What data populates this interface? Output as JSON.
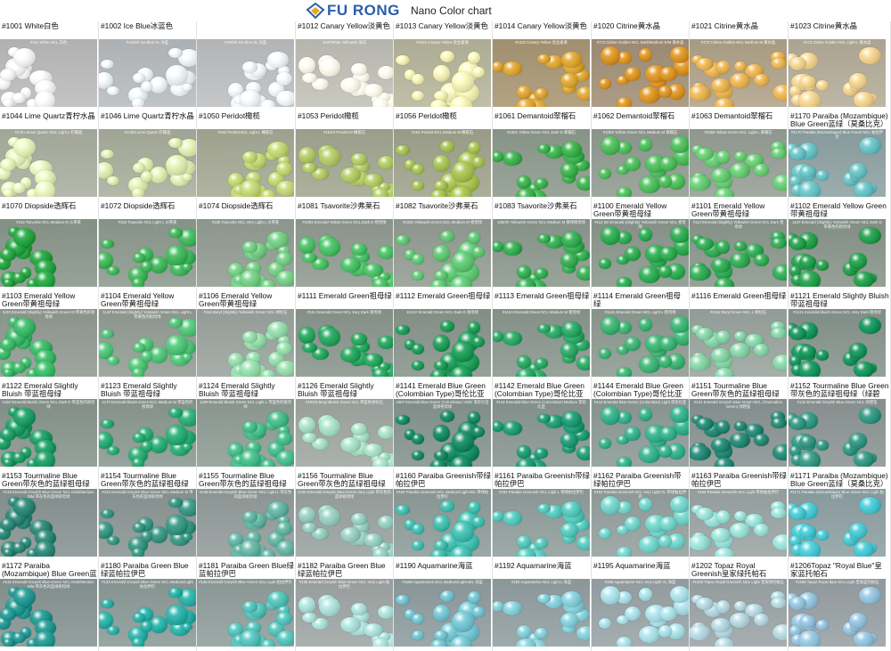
{
  "header": {
    "brand": "FU RONG",
    "chart_title": "Nano Color chart",
    "brand_color": "#2c5ea8",
    "logo_icon": "diamond-logo-icon"
  },
  "rows": [
    [
      {
        "label": "#1001 White白色",
        "cap": "#101 White NCL 白色",
        "color": "#e8e8e8",
        "photo_bg": "#b8b8b8"
      },
      {
        "label": "#1002 Ice Blue冰蓝色",
        "cap": "#1002# Ice Blue VL 冰蓝",
        "color": "#dfe6ea",
        "photo_bg": "#b5b8ba"
      },
      {
        "label": "",
        "cap": "#1002# Ice Blue SL 冰蓝",
        "color": "#e2e8ec",
        "photo_bg": "#b9bbbd"
      },
      {
        "label": "#1012 Canary Yellow淡黄色",
        "cap": "102#White Yellowish 米白",
        "color": "#eeeede",
        "photo_bg": "#bdbdb5"
      },
      {
        "label": "#1013 Canary Yellow淡黄色",
        "cap": "#1022 Canary Yellow 金丝雀黄",
        "color": "#e5e3a8",
        "photo_bg": "#b4b39b"
      },
      {
        "label": "#1014 Canary Yellow淡黄色",
        "cap": "#1023 Canary Yellow 金丝雀黄",
        "color": "#d09a2c",
        "photo_bg": "#a89776"
      },
      {
        "label": "#1020 Citrine黄水晶",
        "cap": "#173 Citrine Golden NCL Dark/Medium D/M 黄水晶",
        "color": "#cf8a1e",
        "photo_bg": "#a2917a"
      },
      {
        "label": "#1021 Citrine黄水晶",
        "cap": "#172 Citrine Golden NCL Medium M 黄水晶",
        "color": "#dba84a",
        "photo_bg": "#aea28b"
      },
      {
        "label": "#1023 Citrine黄水晶",
        "cap": "#173 Citrine Golden NCL Light L 黄水晶",
        "color": "#e3c685",
        "photo_bg": "#b3ab9a"
      }
    ],
    [
      {
        "label": "#1044 Lime Quartz青柠水晶",
        "cap": "#178 Lemon Quartz NCL Light L 柠檬晶",
        "color": "#d8e4b0",
        "photo_bg": "#a9ad9f"
      },
      {
        "label": "#1046 Lime Quartz青柠水晶",
        "cap": "#178/2 Lime Quartz 柠檬晶",
        "color": "#d2dea6",
        "photo_bg": "#a8ac9c"
      },
      {
        "label": "#1050 Peridot橄榄",
        "cap": "#152 Peridot NCL Light L 橄榄石",
        "color": "#b5c96a",
        "photo_bg": "#a4a895"
      },
      {
        "label": "#1053 Peridot橄榄",
        "cap": "#152/3 Peridot M 橄榄石",
        "color": "#a6bd5d",
        "photo_bg": "#a1a591"
      },
      {
        "label": "#1056 Peridot橄榄",
        "cap": "#153 Peridot NCL Medium M 橄榄石",
        "color": "#9bb54a",
        "photo_bg": "#9fa38e"
      },
      {
        "label": "#1061 Demantoid翠榴石",
        "cap": "#1061 Yellow Green NCL Dark D 翠榴石",
        "color": "#33a545",
        "photo_bg": "#8f9a8f"
      },
      {
        "label": "#1062 Demantoid翠榴石",
        "cap": "#1069 Yellow Green NCL Medium M 翠榴石",
        "color": "#45b152",
        "photo_bg": "#929b92"
      },
      {
        "label": "#1063 Demantoid翠榴石",
        "cap": "#1069 Yellow Green NCL Light L 翠榴石",
        "color": "#5ec06a",
        "photo_bg": "#969e96"
      },
      {
        "label": "#1170 Paraiba (Mozambique) Blue Green蓝绿（莫桑比克）帕拉伊巴",
        "cap": "#1170 Paraiba (Mozambique) Blue Green NCL 帕拉伊巴",
        "color": "#5fb6b8",
        "photo_bg": "#8fa1a2"
      }
    ],
    [
      {
        "label": "#1070 Diopside透辉石",
        "cap": "#153 Tsavorite NCL Medium M 沙弗莱",
        "color": "#1f9a3a",
        "photo_bg": "#8b978c"
      },
      {
        "label": "#1072 Diopside透辉石",
        "cap": "#154 Tsavorite NCL Light L 沙弗莱",
        "color": "#38ab52",
        "photo_bg": "#8e9a8f"
      },
      {
        "label": "#1074 Diopside透辉石",
        "cap": "#155 Tsavorite NCL Very Light L 沙弗莱",
        "color": "#6bc17a",
        "photo_bg": "#939d94"
      },
      {
        "label": "#1081 Tsavorite沙弗莱石",
        "cap": "#1081 Emerald Yellow Green NCL Dark D 祖母绿",
        "color": "#41b35c",
        "photo_bg": "#929b92"
      },
      {
        "label": "#1082 Tsavorite沙弗莱石",
        "cap": "#1082 Yellowish Green NCL Medium M 祖母绿",
        "color": "#58bb6c",
        "photo_bg": "#949c94"
      },
      {
        "label": "#1083 Tsavorite沙弗莱石",
        "cap": "108/3# Yellowish Green NCL Medium M 黄绿祖母绿",
        "color": "#2ea24a",
        "photo_bg": "#8d988e"
      },
      {
        "label": "#1100 Emerald Yellow Green带黄祖母绿",
        "cap": "#112 5D Emerald (Slightly) Yellowish Green NCL 祖母绿",
        "color": "#27a04a",
        "photo_bg": "#8c978d"
      },
      {
        "label": "#1101 Emerald Yellow Green带黄祖母绿",
        "cap": "#112 Emerald (Slightly) Yellowish Green NCL Dark 祖母绿",
        "color": "#2a9f4c",
        "photo_bg": "#8c978d"
      },
      {
        "label": "#1102 Emerald Yellow Green带黄祖母绿",
        "cap": "112# Emerald (Slightly) Yellowish Green NCL Dark D 带黄色的祖母绿",
        "color": "#1d9443",
        "photo_bg": "#8a958b"
      }
    ],
    [
      {
        "label": "#1103 Emerald Yellow Green带黄祖母绿",
        "cap": "113# Emerald (Slightly) Yellowish Green M 带黄色的祖母绿",
        "color": "#33ad5e",
        "photo_bg": "#919b93"
      },
      {
        "label": "#1104 Emerald Yellow Green带黄祖母绿",
        "cap": "114# Emerald (Slightly) Yellowish Green NCL Light L 带黄色的祖母绿",
        "color": "#48b86e",
        "photo_bg": "#949d95"
      },
      {
        "label": "#1106 Emerald Yellow Green带黄祖母绿",
        "cap": "#116 Beryl (Slightly) Yellowish Green NCL 绿柱石",
        "color": "#8bcea0",
        "photo_bg": "#9ca39e"
      },
      {
        "label": "#1111 Emerald Green祖母绿",
        "cap": "#111 Emerald Green NCL Very Dark 祖母绿",
        "color": "#1f9a55",
        "photo_bg": "#8b968f"
      },
      {
        "label": "#1112 Emerald Green祖母绿",
        "cap": "112A# Emerald Green NCL Dark D 祖母绿",
        "color": "#16914f",
        "photo_bg": "#89958d"
      },
      {
        "label": "#1113 Emerald Green祖母绿",
        "cap": "#113A Emerald Green NCL Medium M 祖母绿",
        "color": "#239c5c",
        "photo_bg": "#8c9790"
      },
      {
        "label": "#1114 Emerald Green祖母绿",
        "cap": "#114A Emerald Green NCL Light L 祖母绿",
        "color": "#36a86a",
        "photo_bg": "#8f9a93"
      },
      {
        "label": "#1116 Emerald Green祖母绿",
        "cap": "#1162 Beryl Green NCL L 绿柱石",
        "color": "#7dc79d",
        "photo_bg": "#9aa39d"
      },
      {
        "label": "#1121 Emerald Slightly Bluish 带蓝祖母绿",
        "cap": "#1121 Emerald Bluish Green NCL Very Dark 祖母绿",
        "color": "#0f8a53",
        "photo_bg": "#88958e"
      }
    ],
    [
      {
        "label": "#1122 Emerald Slightly Bluish 带蓝祖母绿",
        "cap": "116# Emerald Bluish Green NCL Dark D 带蓝色的祖母绿",
        "color": "#16925c",
        "photo_bg": "#89968f"
      },
      {
        "label": "#1123 Emerald Slightly Bluish 带蓝祖母绿",
        "cap": "117# Emerald Bluish Green NCL Medium M 带蓝色的祖母绿",
        "color": "#22a06a",
        "photo_bg": "#8c9892"
      },
      {
        "label": "#1124 Emerald Slightly Bluish 带蓝祖母绿",
        "cap": "118# Emerald Bluish Green NCL Light L 带蓝色的祖母绿",
        "color": "#3cb07e",
        "photo_bg": "#909c96"
      },
      {
        "label": "#1126 Emerald Slightly Bluish 带蓝祖母绿",
        "cap": "#103/3 Beryl Bluish Green NCL 带蓝色绿柱石",
        "color": "#9dd2b8",
        "photo_bg": "#9fa6a2"
      },
      {
        "label": "#1141 Emerald Blue Green (Colombian Type)哥伦比亚蓝祖母绿",
        "cap": "105# Emerald Blue-Green (Colombian) VD/D 哥伦比亚蓝绿祖母绿",
        "color": "#0f7f5a",
        "photo_bg": "#879490"
      },
      {
        "label": "#1142 Emerald Blue Green (Colombian Type)哥伦比亚蓝祖母绿",
        "cap": "#142 Emerald Blue-Green (Colombian) Medium 哥伦比亚",
        "color": "#17906a",
        "photo_bg": "#899692"
      },
      {
        "label": "#1144 Emerald Blue Green (Colombian Type)哥伦比亚蓝祖母绿",
        "cap": "#144 Emerald Blue-Green (Colombian) Light 哥伦比亚",
        "color": "#2ea581",
        "photo_bg": "#8e9a96"
      },
      {
        "label": "#1151 Tourmaline Blue Green带灰色的蓝绿祖母绿（绿碧玺）",
        "cap": "#131 Emerald Greyish Blue-Green NCL (Tourmaline Green) 绿碧玺",
        "color": "#1c7d6a",
        "photo_bg": "#8a9492"
      },
      {
        "label": "#1152 Tourmaline Blue Green带灰色的蓝绿祖母绿（绿碧玺）",
        "cap": "#132 Emerald Greyish Blue-Green NCL 绿碧玺",
        "color": "#2a8c78",
        "photo_bg": "#8d9694"
      }
    ],
    [
      {
        "label": "#1153 Tourmaline Blue Green带灰色的蓝绿祖母绿（绿碧玺）",
        "cap": "#133 Emerald Greyish Blue-Green NCL Dark/Medium D/M 带灰色的蓝绿祖母绿",
        "color": "#247d6c",
        "photo_bg": "#8a9492"
      },
      {
        "label": "#1154 Tourmaline Blue Green带灰色的蓝绿祖母绿（绿碧玺）",
        "cap": "#134 Emerald Greyish Blue-Green NCL Medium M 带灰色的蓝绿祖母绿",
        "color": "#2f8b78",
        "photo_bg": "#8c9694"
      },
      {
        "label": "#1155 Tourmaline Blue Green带灰色的蓝绿祖母绿（绿碧玺）",
        "cap": "#135 Emerald Greyish Blue-Green NCL Light L 带灰色的蓝绿祖母绿",
        "color": "#5aa898",
        "photo_bg": "#939c9a"
      },
      {
        "label": "#1156 Tourmaline Blue Green带灰色的蓝绿祖母绿（绿碧玺）",
        "cap": "#136 Emerald Greyish Blue-Green Very Light 带灰色的蓝绿祖母绿",
        "color": "#8cc0b3",
        "photo_bg": "#9aa2a0"
      },
      {
        "label": "#1160 Paraiba Greenish带绿帕拉伊巴",
        "cap": "#160 Paraiba Greenish NCL Medium/Light M/L 带绿帕拉伊巴",
        "color": "#39b2a4",
        "photo_bg": "#8f9c9a"
      },
      {
        "label": "#1161 Paraiba Greenish带绿帕拉伊巴",
        "cap": "#161 Paraiba Greenish NCL Light L 带绿帕拉伊巴",
        "color": "#4dbcb0",
        "photo_bg": "#929e9c"
      },
      {
        "label": "#1162 Paraiba Greenish带绿帕拉伊巴",
        "cap": "#162 Paraiba Greenish NCL Very Light VL 带绿帕拉伊巴",
        "color": "#6ac7bd",
        "photo_bg": "#95a09e"
      },
      {
        "label": "#1163 Paraiba Greenish带绿帕拉伊巴",
        "cap": "#163 Paraiba Greenish NCL Light 带绿帕拉伊巴",
        "color": "#8fd3ca",
        "photo_bg": "#9ba4a2"
      },
      {
        "label": "#1171 Paraiba (Mozambique) Blue Green蓝绿（莫桑比克）帕拉伊巴",
        "cap": "#1171 Paraiba (Mozambique) Blue Green NCL Light 帕拉伊巴",
        "color": "#3fbcc6",
        "photo_bg": "#8fa0a3"
      }
    ],
    [
      {
        "label": "#1172 Paraiba (Mozambique) Blue Green蓝绿（莫桑比克）帕拉伊巴",
        "cap": "#131 Emerald Greyish Blue-Green NCL Dark/Medium D/M 带灰色的蓝绿祖母绿",
        "color": "#1c8d88",
        "photo_bg": "#899594"
      },
      {
        "label": "#1180 Paraiba Green Blue绿蓝帕拉伊巴",
        "cap": "#134 Emerald Greyish Blue-Green NCL Medium/Light 帕拉伊巴",
        "color": "#22a59c",
        "photo_bg": "#8c9a98"
      },
      {
        "label": "#1181 Paraiba Green Blue绿蓝帕拉伊巴",
        "cap": "#135 Emerald Greyish Blue-Green NCL Light 帕拉伊巴",
        "color": "#4bb6ae",
        "photo_bg": "#919e9c"
      },
      {
        "label": "#1182 Paraiba Green Blue绿蓝帕拉伊巴",
        "cap": "#136 Emerald Greyish Blue-Green NCL Very Light 帕拉伊巴",
        "color": "#a2d2cd",
        "photo_bg": "#9ea5a4"
      },
      {
        "label": "#1190 Aquamarine海蓝",
        "cap": "#1190 Aquamarine NCL Medium/Light M/L 海蓝",
        "color": "#6ab8c4",
        "photo_bg": "#909c9e"
      },
      {
        "label": "#1192 Aquamarine海蓝",
        "cap": "#192 Aquamarine NCL Light L 海蓝",
        "color": "#7cc2cc",
        "photo_bg": "#939ea0"
      },
      {
        "label": "#1195 Aquamarine海蓝",
        "cap": "#195 Aquamarine NCL Very Light VL 海蓝",
        "color": "#9fd2d9",
        "photo_bg": "#99a2a4"
      },
      {
        "label": "#1202 Topaz Royal Greenish皇家绿托帕石",
        "cap": "#1202 Topaz Royal Greenish NCL Light 皇家绿托帕石",
        "color": "#a8c9d2",
        "photo_bg": "#9ca3a5"
      },
      {
        "label": "#1206Topaz \"Royal Blue\"皇家蓝托帕石",
        "cap": "#1206 Topaz Royal Blue NCL Light 皇家蓝托帕石",
        "color": "#8ab7d0",
        "photo_bg": "#98a0a4"
      }
    ]
  ]
}
